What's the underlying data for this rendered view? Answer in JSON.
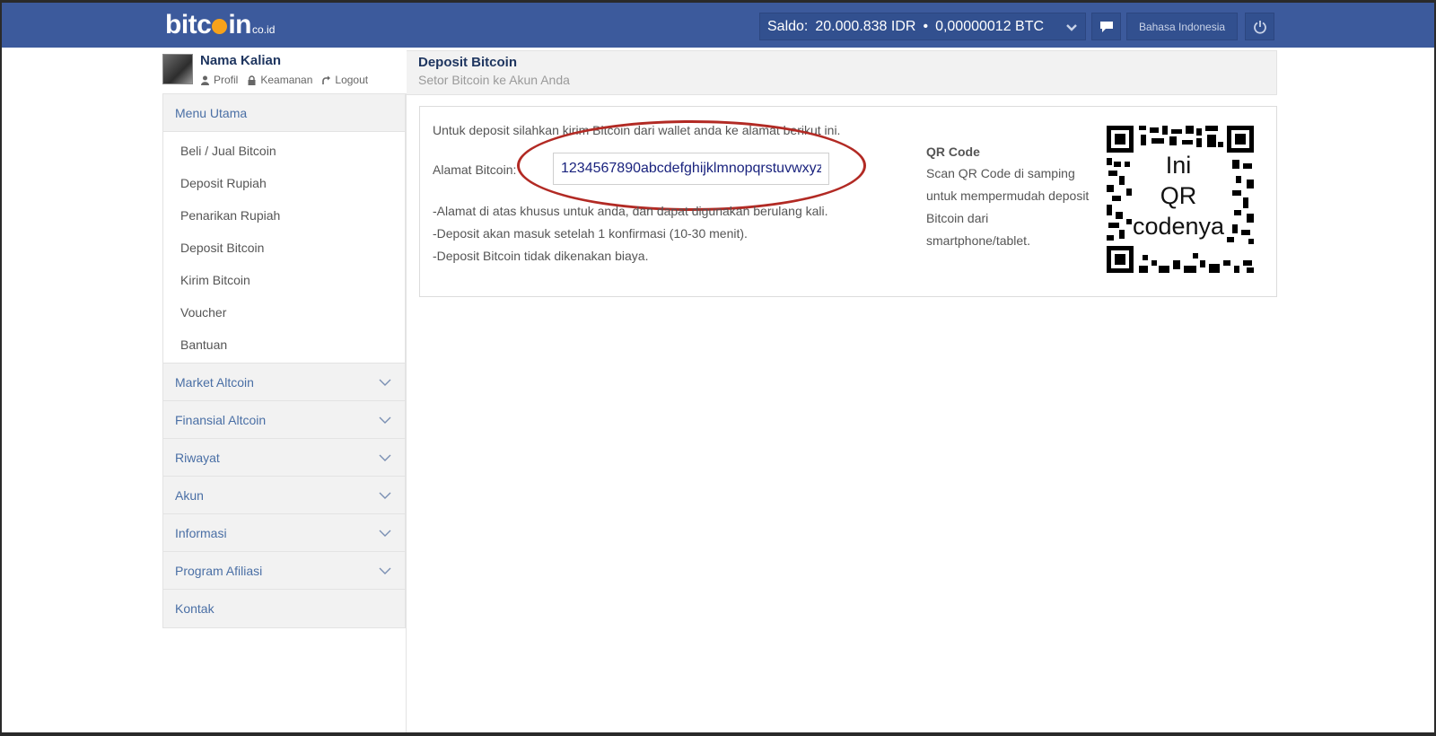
{
  "topbar": {
    "logo_word_a": "bitc",
    "logo_word_b": "in",
    "logo_tld": "co.id",
    "saldo_label": "Saldo:",
    "saldo_idr": "20.000.838 IDR",
    "saldo_sep": "•",
    "saldo_btc": "0,00000012 BTC",
    "language": "Bahasa Indonesia"
  },
  "profile": {
    "name": "Nama Kalian",
    "links": [
      "Profil",
      "Keamanan",
      "Logout"
    ]
  },
  "sidebar": {
    "main_menu": {
      "label": "Menu Utama",
      "items": [
        "Beli / Jual Bitcoin",
        "Deposit Rupiah",
        "Penarikan Rupiah",
        "Deposit Bitcoin",
        "Kirim Bitcoin",
        "Voucher",
        "Bantuan"
      ]
    },
    "sections": [
      "Market Altcoin",
      "Finansial Altcoin",
      "Riwayat",
      "Akun",
      "Informasi",
      "Program Afiliasi"
    ],
    "last": "Kontak"
  },
  "page": {
    "title": "Deposit Bitcoin",
    "subtitle": "Setor Bitcoin ke Akun Anda"
  },
  "deposit": {
    "intro": "Untuk deposit silahkan kirim Bitcoin dari wallet anda ke alamat berikut ini.",
    "address_label": "Alamat Bitcoin:",
    "address_value": "1234567890abcdefghijklmnopqrstuvwxyz",
    "notes": [
      "-Alamat di atas khusus untuk anda, dan dapat digunakan berulang kali.",
      "-Deposit akan masuk setelah 1 konfirmasi (10-30 menit).",
      "-Deposit Bitcoin tidak dikenakan biaya."
    ],
    "qr_title": "QR Code",
    "qr_desc": "Scan QR Code di samping untuk mempermudah deposit Bitcoin dari smartphone/tablet.",
    "qr_overlay_lines": [
      "Ini",
      "QR",
      "codenya"
    ]
  },
  "colors": {
    "topbar": "#3c5a9c",
    "accent_text": "#4a6fa5",
    "title": "#1f3660",
    "highlight_ellipse": "#b22a24",
    "logo_coin": "#f7a21b"
  }
}
